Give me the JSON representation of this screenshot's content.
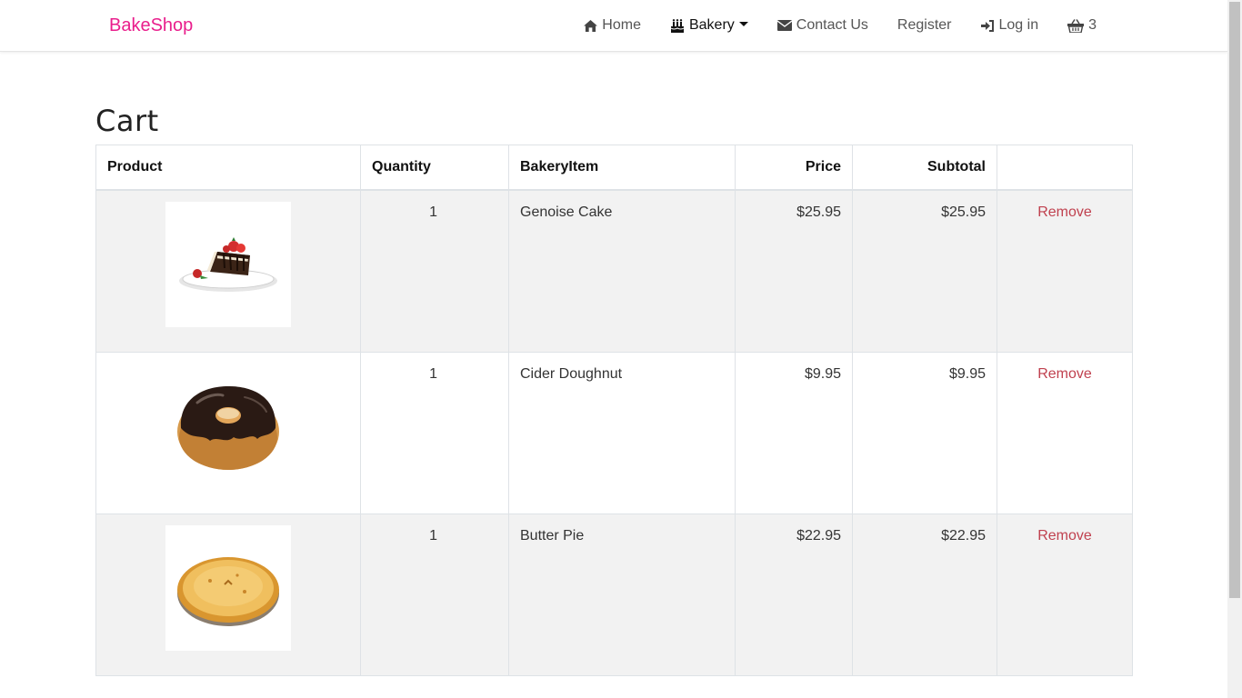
{
  "brand": "BakeShop",
  "nav": {
    "home": "Home",
    "bakery": "Bakery",
    "contact": "Contact Us",
    "register": "Register",
    "login": "Log in",
    "cart_count": "3"
  },
  "page": {
    "title": "Cart"
  },
  "table": {
    "headers": {
      "product": "Product",
      "quantity": "Quantity",
      "item": "BakeryItem",
      "price": "Price",
      "subtotal": "Subtotal"
    },
    "rows": [
      {
        "quantity": "1",
        "item": "Genoise Cake",
        "price": "$25.95",
        "subtotal": "$25.95",
        "action": "Remove",
        "image": "cake-slice"
      },
      {
        "quantity": "1",
        "item": "Cider Doughnut",
        "price": "$9.95",
        "subtotal": "$9.95",
        "action": "Remove",
        "image": "chocolate-doughnut"
      },
      {
        "quantity": "1",
        "item": "Butter Pie",
        "price": "$22.95",
        "subtotal": "$22.95",
        "action": "Remove",
        "image": "pie"
      }
    ]
  },
  "colors": {
    "brand": "#e91e8c",
    "remove": "#c0414f",
    "row_stripe": "#f2f2f2"
  }
}
